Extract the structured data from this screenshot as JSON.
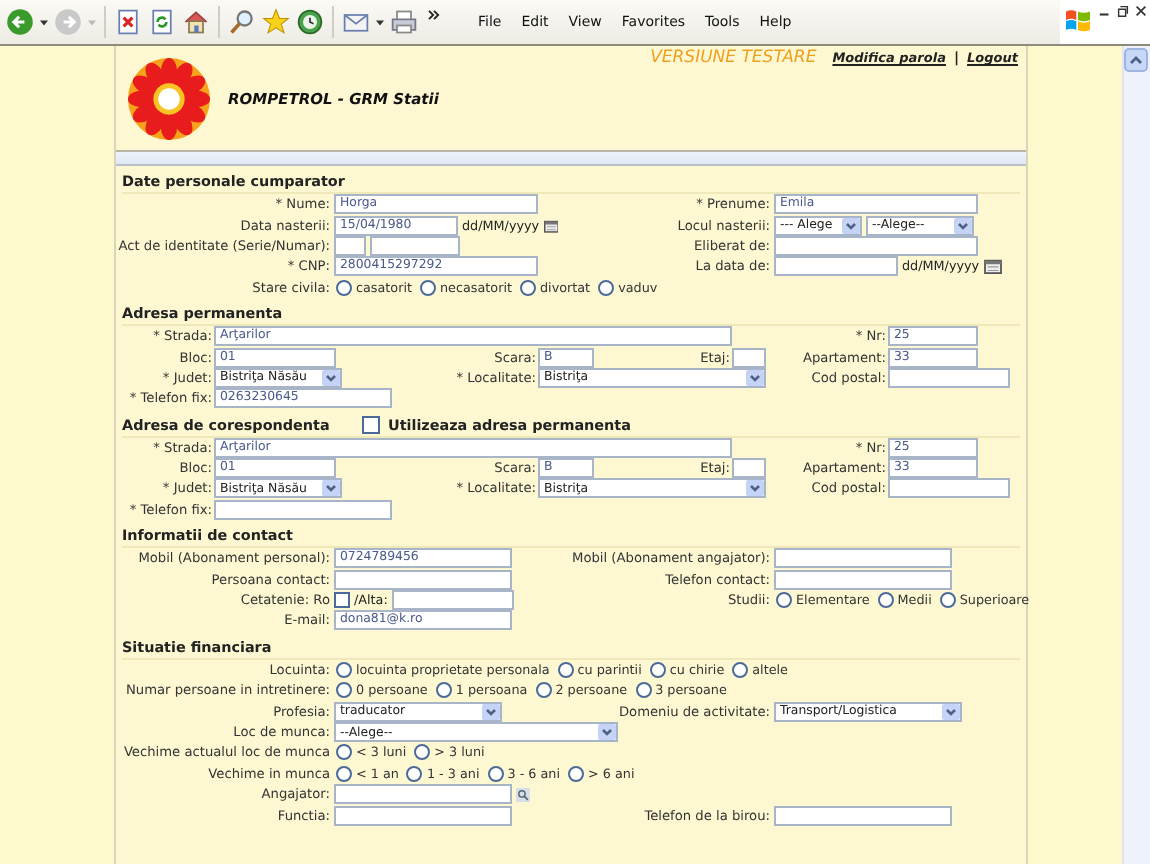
{
  "browser": {
    "menu": [
      "File",
      "Edit",
      "View",
      "Favorites",
      "Tools",
      "Help"
    ]
  },
  "header": {
    "notice": "VERSIUNE TESTARE",
    "links": [
      "Modifica parola",
      "Logout"
    ],
    "separator": "|",
    "title": "ROMPETROL - GRM Statii"
  },
  "sections": [
    {
      "title": "Date personale cumparator",
      "kind": "pairs",
      "rows": [
        {
          "left": {
            "label": "* Nume:",
            "controls": [
              {
                "kind": "input",
                "value": "Horga"
              }
            ]
          },
          "right": {
            "label": "* Prenume:",
            "controls": [
              {
                "kind": "input",
                "value": "Emila"
              }
            ]
          }
        },
        {
          "left": {
            "label": "Data nasterii:",
            "controls": [
              {
                "kind": "date-input",
                "value": "15/04/1980"
              },
              {
                "kind": "text",
                "text": "dd/MM/yyyy"
              },
              {
                "kind": "calendar"
              }
            ]
          },
          "right": {
            "label": "Locul nasterii:",
            "controls": [
              {
                "kind": "select-narrow",
                "value": "--- Alege"
              },
              {
                "kind": "select",
                "value": "--Alege--"
              }
            ]
          }
        },
        {
          "left": {
            "label": "Act de identitate (Serie/Numar):",
            "controls": [
              {
                "kind": "series-input"
              },
              {
                "kind": "number-input"
              }
            ]
          },
          "right": {
            "label": "Eliberat de:",
            "controls": [
              {
                "kind": "input"
              }
            ]
          }
        },
        {
          "left": {
            "label": "* CNP:",
            "controls": [
              {
                "kind": "input",
                "value": "2800415297292"
              }
            ]
          },
          "right": {
            "label": "La data de:",
            "controls": [
              {
                "kind": "date-input"
              },
              {
                "kind": "text",
                "text": "dd/MM/yyyy"
              },
              {
                "kind": "calendar"
              }
            ]
          }
        },
        {
          "left": {
            "label": "Stare civila:",
            "controls": [
              {
                "kind": "radio",
                "label": "casatorit",
                "checked": false
              },
              {
                "kind": "radio",
                "label": "necasatorit",
                "checked": false
              },
              {
                "kind": "radio",
                "label": "divortat",
                "checked": false
              },
              {
                "kind": "radio",
                "label": "vaduv",
                "checked": false
              }
            ]
          }
        }
      ]
    },
    {
      "title": "Adresa permanenta",
      "kind": "address",
      "rows": [
        {
          "kind": "street",
          "fields": [
            {
              "label": "* Strada:",
              "controls": [
                {
                  "kind": "street-input",
                  "value": "Arţarilor"
                }
              ]
            },
            {
              "label": "* Nr:",
              "controls": [
                {
                  "kind": "number-input",
                  "value": "25"
                }
              ]
            }
          ]
        },
        {
          "kind": "units",
          "fields": [
            {
              "label": "Bloc:",
              "controls": [
                {
                  "kind": "short-input",
                  "value": "01"
                }
              ]
            },
            {
              "label": "Scara:",
              "controls": [
                {
                  "kind": "tiny-input",
                  "value": "B"
                }
              ]
            },
            {
              "label": "Etaj:",
              "controls": [
                {
                  "kind": "mini-input"
                }
              ]
            },
            {
              "label": "Apartament:",
              "controls": [
                {
                  "kind": "number-input",
                  "value": "33"
                }
              ]
            }
          ]
        },
        {
          "kind": "region",
          "fields": [
            {
              "label": "* Judet:",
              "controls": [
                {
                  "kind": "select-county",
                  "value": "Bistriţa Năsău"
                }
              ]
            },
            {
              "label": "* Localitate:",
              "controls": [
                {
                  "kind": "select-locality",
                  "value": "Bistriţa"
                }
              ]
            },
            {
              "label": "Cod postal:",
              "controls": [
                {
                  "kind": "short-input"
                }
              ]
            }
          ]
        },
        {
          "kind": "phone",
          "fields": [
            {
              "label": "* Telefon fix:",
              "controls": [
                {
                  "kind": "contact-input",
                  "value": "0263230645"
                }
              ]
            }
          ]
        }
      ]
    },
    {
      "title": "Adresa de corespondenta",
      "kind": "address",
      "option": {
        "label": "Utilizeaza adresa permanenta",
        "checked": false
      },
      "rows": [
        {
          "kind": "street",
          "fields": [
            {
              "label": "* Strada:",
              "controls": [
                {
                  "kind": "street-input",
                  "value": "Arţarilor"
                }
              ]
            },
            {
              "label": "* Nr:",
              "controls": [
                {
                  "kind": "number-input",
                  "value": "25"
                }
              ]
            }
          ]
        },
        {
          "kind": "units",
          "fields": [
            {
              "label": "Bloc:",
              "controls": [
                {
                  "kind": "short-input",
                  "value": "01"
                }
              ]
            },
            {
              "label": "Scara:",
              "controls": [
                {
                  "kind": "tiny-input",
                  "value": "B"
                }
              ]
            },
            {
              "label": "Etaj:",
              "controls": [
                {
                  "kind": "mini-input"
                }
              ]
            },
            {
              "label": "Apartament:",
              "controls": [
                {
                  "kind": "number-input",
                  "value": "33"
                }
              ]
            }
          ]
        },
        {
          "kind": "region",
          "fields": [
            {
              "label": "* Judet:",
              "controls": [
                {
                  "kind": "select-county",
                  "value": "Bistriţa Năsău"
                }
              ]
            },
            {
              "label": "* Localitate:",
              "controls": [
                {
                  "kind": "select-locality",
                  "value": "Bistriţa"
                }
              ]
            },
            {
              "label": "Cod postal:",
              "controls": [
                {
                  "kind": "short-input"
                }
              ]
            }
          ]
        },
        {
          "kind": "phone",
          "fields": [
            {
              "label": "* Telefon fix:",
              "controls": [
                {
                  "kind": "contact-input"
                }
              ]
            }
          ]
        }
      ]
    },
    {
      "title": "Informatii de contact",
      "kind": "pairs",
      "rows": [
        {
          "left": {
            "label": "Mobil (Abonament personal):",
            "controls": [
              {
                "kind": "contact-input",
                "value": "0724789456"
              }
            ]
          },
          "right": {
            "label": "Mobil (Abonament angajator):",
            "controls": [
              {
                "kind": "contact-input"
              }
            ]
          }
        },
        {
          "left": {
            "label": "Persoana contact:",
            "controls": [
              {
                "kind": "contact-input"
              }
            ]
          },
          "right": {
            "label": "Telefon contact:",
            "controls": [
              {
                "kind": "contact-input"
              }
            ]
          }
        },
        {
          "left": {
            "label": "Cetatenie: Ro",
            "controls": [
              {
                "kind": "checkbox",
                "checked": false
              },
              {
                "kind": "text",
                "text": "/Alta:"
              },
              {
                "kind": "short-input"
              }
            ]
          },
          "right": {
            "label": "Studii:",
            "controls": [
              {
                "kind": "radio",
                "label": "Elementare",
                "checked": false
              },
              {
                "kind": "radio",
                "label": "Medii",
                "checked": false
              },
              {
                "kind": "radio",
                "label": "Superioare",
                "checked": false
              }
            ]
          }
        },
        {
          "left": {
            "label": "E-mail:",
            "controls": [
              {
                "kind": "contact-input",
                "value": "dona81@k.ro"
              }
            ]
          }
        }
      ]
    },
    {
      "title": "Situatie financiara",
      "kind": "pairs",
      "rows": [
        {
          "left": {
            "label": "Locuinta:",
            "controls": [
              {
                "kind": "radio",
                "label": "locuinta proprietate personala",
                "checked": false
              },
              {
                "kind": "radio",
                "label": "cu parintii",
                "checked": false
              },
              {
                "kind": "radio",
                "label": "cu chirie",
                "checked": false
              },
              {
                "kind": "radio",
                "label": "altele",
                "checked": false
              }
            ]
          }
        },
        {
          "left": {
            "label": "Numar persoane in intretinere:",
            "controls": [
              {
                "kind": "radio",
                "label": "0 persoane",
                "checked": false
              },
              {
                "kind": "radio",
                "label": "1 persoana",
                "checked": false
              },
              {
                "kind": "radio",
                "label": "2 persoane",
                "checked": false
              },
              {
                "kind": "radio",
                "label": "3 persoane",
                "checked": false
              }
            ]
          }
        },
        {
          "left": {
            "label": "Profesia:",
            "controls": [
              {
                "kind": "select-profession",
                "value": "traducator"
              }
            ]
          },
          "right": {
            "label": "Domeniu de activitate:",
            "controls": [
              {
                "kind": "select-domain",
                "value": "Transport/Logistica"
              }
            ]
          }
        },
        {
          "left": {
            "label": "Loc de munca:",
            "controls": [
              {
                "kind": "select-wide",
                "value": "--Alege--"
              }
            ]
          }
        },
        {
          "left": {
            "label": "Vechime actualul loc de munca",
            "controls": [
              {
                "kind": "radio",
                "label": "< 3 luni",
                "checked": false
              },
              {
                "kind": "radio",
                "label": "> 3 luni",
                "checked": false
              }
            ]
          }
        },
        {
          "left": {
            "label": "Vechime in munca",
            "controls": [
              {
                "kind": "radio",
                "label": "< 1 an",
                "checked": false
              },
              {
                "kind": "radio",
                "label": "1 - 3 ani",
                "checked": false
              },
              {
                "kind": "radio",
                "label": "3 - 6 ani",
                "checked": false
              },
              {
                "kind": "radio",
                "label": "> 6 ani",
                "checked": false
              }
            ]
          }
        },
        {
          "left": {
            "label": "Angajator:",
            "controls": [
              {
                "kind": "contact-input"
              },
              {
                "kind": "lookup"
              }
            ]
          }
        },
        {
          "left": {
            "label": "Functia:",
            "controls": [
              {
                "kind": "contact-input"
              }
            ]
          },
          "right": {
            "label": "Telefon de la birou:",
            "controls": [
              {
                "kind": "contact-input"
              }
            ]
          }
        }
      ]
    }
  ]
}
